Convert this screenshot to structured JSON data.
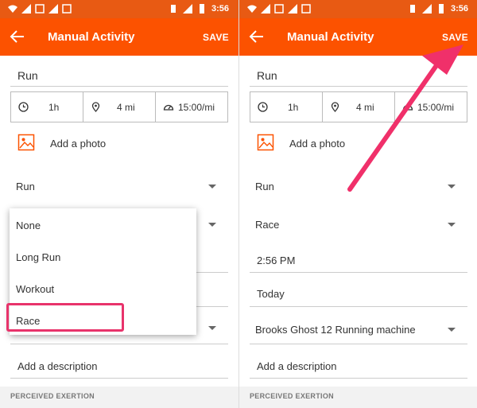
{
  "status_bar": {
    "time": "3:56"
  },
  "app_bar": {
    "title": "Manual Activity",
    "save_label": "SAVE"
  },
  "activity": {
    "name": "Run",
    "duration": "1h",
    "distance": "4 mi",
    "pace": "15:00/mi",
    "add_photo_label": "Add a photo",
    "sport_type": "Run",
    "add_description_label": "Add a description",
    "perceived_exertion_label": "PERCEIVED EXERTION"
  },
  "dropdown": {
    "options": [
      "None",
      "Long Run",
      "Workout",
      "Race"
    ],
    "selected": "Race"
  },
  "right_panel": {
    "workout_type": "Race",
    "time": "2:56 PM",
    "date": "Today",
    "gear": "Brooks Ghost 12 Running machine"
  },
  "colors": {
    "status_bar": "#e85a13",
    "app_bar": "#fc5200",
    "highlight": "#e8336b",
    "arrow": "#f0306a"
  }
}
